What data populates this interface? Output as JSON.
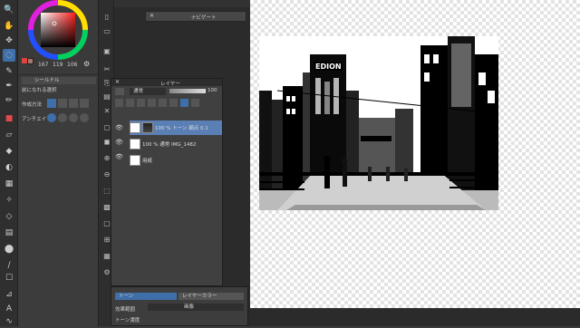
{
  "color": {
    "r": "167",
    "g": "119",
    "b": "106",
    "main_hex": "#a7776a"
  },
  "subtool": {
    "header": "シールドル",
    "item1": "前になれる選択",
    "item2_label": "作成方法",
    "item3_label": "アンチエイリ"
  },
  "float_title": "ナビゲート",
  "layer_panel": {
    "title": "レイヤー",
    "blend_mode": "通常",
    "opacity": "100",
    "layers": [
      {
        "name": "100 %  トーン\n網点 0.1",
        "type": "tone"
      },
      {
        "name": "100 %  通常\nIMG_1482",
        "type": "image"
      },
      {
        "name": "用紙",
        "type": "paper"
      }
    ]
  },
  "property_panel": {
    "tab1": "トーン",
    "tab2": "レイヤーカラー",
    "label1": "効果範囲",
    "value1": "画像",
    "label2": "トーン濃度"
  },
  "artwork": {
    "sign": "EDION"
  }
}
